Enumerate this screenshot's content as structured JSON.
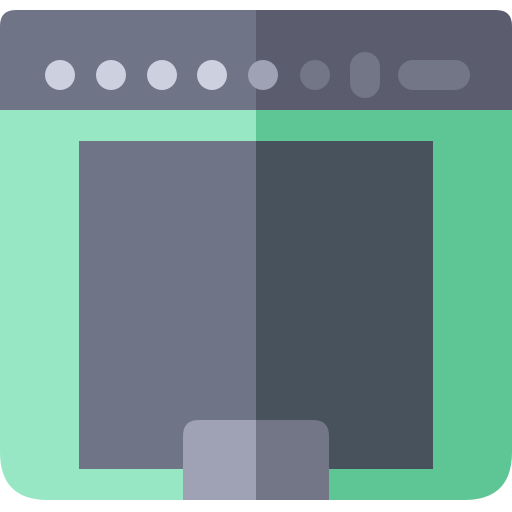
{
  "icon": {
    "name": "oven-icon",
    "colors": {
      "panel_left": "#707487",
      "panel_right": "#5b5d6e",
      "knob_light": "#cdd0de",
      "knob_dim": "#9ea2b4",
      "knob_dark": "#737686",
      "body_left": "#97e7c5",
      "body_right": "#5ec594",
      "window_left": "#707487",
      "window_right": "#47525d",
      "handle_left": "#9ea2b4",
      "handle_right": "#737686"
    }
  }
}
